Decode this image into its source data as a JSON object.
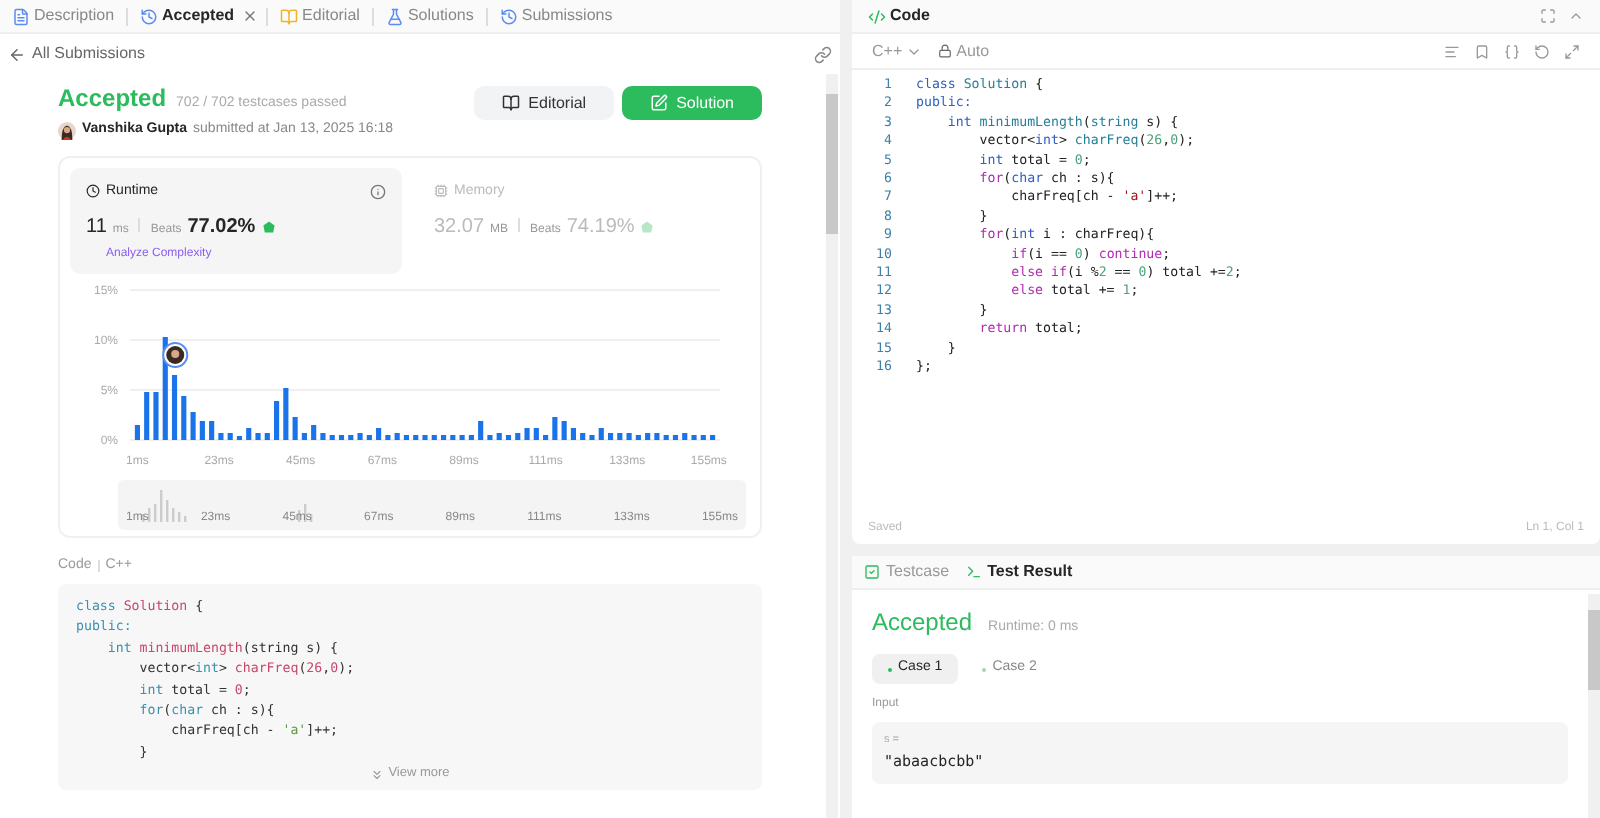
{
  "left_tabs": [
    {
      "label": "Description",
      "kind": "description",
      "selected": false,
      "closable": false
    },
    {
      "label": "Accepted",
      "kind": "history",
      "selected": true,
      "closable": true
    },
    {
      "label": "Editorial",
      "kind": "book",
      "selected": false,
      "closable": false
    },
    {
      "label": "Solutions",
      "kind": "flask",
      "selected": false,
      "closable": false
    },
    {
      "label": "Submissions",
      "kind": "history",
      "selected": false,
      "closable": false
    }
  ],
  "back_link": "All Submissions",
  "submission": {
    "status": "Accepted",
    "passed": "702 / 702 testcases passed",
    "author": "Vanshika Gupta",
    "submitted": "submitted at Jan 13, 2025 16:18"
  },
  "actions": [
    {
      "label": "Editorial",
      "kind": "secondary"
    },
    {
      "label": "Solution",
      "kind": "primary"
    }
  ],
  "metrics": [
    {
      "title": "Runtime",
      "kind": "time",
      "value": "11",
      "unit": "ms",
      "beats_label": "Beats",
      "beats": "77.02%",
      "selected": true,
      "link": "Analyze Complexity"
    },
    {
      "title": "Memory",
      "kind": "memory",
      "value": "32.07",
      "unit": "MB",
      "beats_label": "Beats",
      "beats": "74.19%",
      "selected": false
    }
  ],
  "chart_data": {
    "type": "bar",
    "x": [
      1,
      3.5,
      6,
      8.5,
      11,
      13.5,
      16,
      18.5,
      21,
      23.5,
      26,
      28.5,
      31,
      33.5,
      36,
      38.5,
      41,
      43.5,
      46,
      48.5,
      51,
      53.5,
      56,
      58.5,
      61,
      63.5,
      66,
      68.5,
      71,
      73.5,
      76,
      78.5,
      81,
      83.5,
      86,
      88.5,
      91,
      93.5,
      96,
      98.5,
      101,
      103.5,
      106,
      108.5,
      111,
      113.5,
      116,
      118.5,
      121,
      123.5,
      126,
      128.5,
      131,
      133.5,
      136,
      138.5,
      141,
      143.5,
      146,
      148.5,
      151,
      153.5,
      156
    ],
    "series": [
      {
        "color": "#1a73e8",
        "values": [
          1.5,
          4.8,
          4.8,
          10.3,
          6.5,
          4.4,
          2.8,
          1.9,
          1.9,
          0.7,
          0.7,
          0.4,
          1.2,
          0.7,
          0.7,
          3.9,
          5.2,
          2.3,
          0.7,
          1.5,
          0.7,
          0.5,
          0.5,
          0.5,
          0.7,
          0.5,
          1.2,
          0.5,
          0.7,
          0.5,
          0.5,
          0.5,
          0.5,
          0.5,
          0.5,
          0.5,
          0.5,
          1.9,
          0.5,
          0.7,
          0.5,
          0.7,
          1.2,
          1.2,
          0.5,
          2.3,
          1.9,
          1.2,
          0.7,
          0.5,
          1.2,
          0.7,
          0.7,
          0.7,
          0.5,
          0.7,
          0.7,
          0.5,
          0.5,
          0.7,
          0.5,
          0.5,
          0.5
        ]
      }
    ],
    "ylim": [
      0,
      15
    ],
    "yticks": [
      {
        "value": 0,
        "label": "0%"
      },
      {
        "value": 5,
        "label": "5%"
      },
      {
        "value": 10,
        "label": "10%"
      },
      {
        "value": 15,
        "label": "15%"
      }
    ],
    "xlim": [
      -1,
      158
    ],
    "xticks": [
      {
        "value": 1,
        "label": "1ms"
      },
      {
        "value": 23,
        "label": "23ms"
      },
      {
        "value": 45,
        "label": "45ms"
      },
      {
        "value": 67,
        "label": "67ms"
      },
      {
        "value": 89,
        "label": "89ms"
      },
      {
        "value": 111,
        "label": "111ms"
      },
      {
        "value": 133,
        "label": "133ms"
      },
      {
        "value": 155,
        "label": "155ms"
      }
    ]
  },
  "range_labels": [
    "1ms",
    "23ms",
    "45ms",
    "67ms",
    "89ms",
    "111ms",
    "133ms",
    "155ms"
  ],
  "code_header": {
    "title": "Code",
    "language": "C++"
  },
  "code_preview": [
    [
      {
        "kind": "keyword",
        "text": "class "
      },
      {
        "kind": "func",
        "text": "Solution"
      },
      {
        "kind": "plain",
        "text": " {"
      }
    ],
    [
      {
        "kind": "keyword",
        "text": "public:"
      }
    ],
    [
      {
        "kind": "keyword",
        "text": "    int "
      },
      {
        "kind": "func",
        "text": "minimumLength"
      },
      {
        "kind": "plain",
        "text": "(string s) {"
      }
    ],
    [
      {
        "kind": "plain",
        "text": "        vector<"
      },
      {
        "kind": "keyword",
        "text": "int"
      },
      {
        "kind": "plain",
        "text": "> "
      },
      {
        "kind": "func",
        "text": "charFreq"
      },
      {
        "kind": "plain",
        "text": "("
      },
      {
        "kind": "number",
        "text": "26"
      },
      {
        "kind": "plain",
        "text": ","
      },
      {
        "kind": "number",
        "text": "0"
      },
      {
        "kind": "plain",
        "text": ");"
      }
    ],
    [
      {
        "kind": "keyword",
        "text": "        int"
      },
      {
        "kind": "plain",
        "text": " total = "
      },
      {
        "kind": "number",
        "text": "0"
      },
      {
        "kind": "plain",
        "text": ";"
      }
    ],
    [
      {
        "kind": "keyword",
        "text": "        for"
      },
      {
        "kind": "plain",
        "text": "("
      },
      {
        "kind": "keyword",
        "text": "char"
      },
      {
        "kind": "plain",
        "text": " ch : s){"
      }
    ],
    [
      {
        "kind": "plain",
        "text": "            charFreq[ch - "
      },
      {
        "kind": "string",
        "text": "'a'"
      },
      {
        "kind": "plain",
        "text": "]++;"
      }
    ],
    [
      {
        "kind": "plain",
        "text": "        }"
      }
    ]
  ],
  "view_more": "View more",
  "editor": {
    "title": "Code",
    "language": "C++",
    "mode": "Auto",
    "status": "Saved",
    "cursor": "Ln 1, Col 1",
    "lines": [
      {
        "no": "1",
        "tokens": [
          {
            "kind": "keyword",
            "text": "class "
          },
          {
            "kind": "func",
            "text": "Solution"
          },
          {
            "kind": "plain",
            "text": " {"
          }
        ]
      },
      {
        "no": "2",
        "tokens": [
          {
            "kind": "keyword",
            "text": "public:"
          }
        ]
      },
      {
        "no": "3",
        "tokens": [
          {
            "kind": "keyword",
            "text": "    int "
          },
          {
            "kind": "func",
            "text": "minimumLength"
          },
          {
            "kind": "plain",
            "text": "("
          },
          {
            "kind": "func",
            "text": "string"
          },
          {
            "kind": "plain",
            "text": " s) {"
          }
        ]
      },
      {
        "no": "4",
        "tokens": [
          {
            "kind": "plain",
            "text": "        vector<"
          },
          {
            "kind": "keyword",
            "text": "int"
          },
          {
            "kind": "plain",
            "text": "> "
          },
          {
            "kind": "func",
            "text": "charFreq"
          },
          {
            "kind": "plain",
            "text": "("
          },
          {
            "kind": "number",
            "text": "26"
          },
          {
            "kind": "plain",
            "text": ","
          },
          {
            "kind": "number",
            "text": "0"
          },
          {
            "kind": "plain",
            "text": ");"
          }
        ]
      },
      {
        "no": "5",
        "tokens": [
          {
            "kind": "keyword",
            "text": "        int"
          },
          {
            "kind": "plain",
            "text": " total = "
          },
          {
            "kind": "number",
            "text": "0"
          },
          {
            "kind": "plain",
            "text": ";"
          }
        ]
      },
      {
        "no": "6",
        "tokens": [
          {
            "kind": "control",
            "text": "        for"
          },
          {
            "kind": "plain",
            "text": "("
          },
          {
            "kind": "keyword",
            "text": "char"
          },
          {
            "kind": "plain",
            "text": " ch : s){"
          }
        ]
      },
      {
        "no": "7",
        "tokens": [
          {
            "kind": "plain",
            "text": "            charFreq[ch - "
          },
          {
            "kind": "string",
            "text": "'a'"
          },
          {
            "kind": "plain",
            "text": "]++;"
          }
        ]
      },
      {
        "no": "8",
        "tokens": [
          {
            "kind": "plain",
            "text": "        }"
          }
        ]
      },
      {
        "no": "9",
        "tokens": [
          {
            "kind": "control",
            "text": "        for"
          },
          {
            "kind": "plain",
            "text": "("
          },
          {
            "kind": "keyword",
            "text": "int"
          },
          {
            "kind": "plain",
            "text": " i : charFreq){"
          }
        ]
      },
      {
        "no": "10",
        "tokens": [
          {
            "kind": "control",
            "text": "            if"
          },
          {
            "kind": "plain",
            "text": "(i == "
          },
          {
            "kind": "number",
            "text": "0"
          },
          {
            "kind": "plain",
            "text": ") "
          },
          {
            "kind": "control",
            "text": "continue"
          },
          {
            "kind": "plain",
            "text": ";"
          }
        ]
      },
      {
        "no": "11",
        "tokens": [
          {
            "kind": "control",
            "text": "            else if"
          },
          {
            "kind": "plain",
            "text": "(i %"
          },
          {
            "kind": "number",
            "text": "2"
          },
          {
            "kind": "plain",
            "text": " == "
          },
          {
            "kind": "number",
            "text": "0"
          },
          {
            "kind": "plain",
            "text": ") total +="
          },
          {
            "kind": "number",
            "text": "2"
          },
          {
            "kind": "plain",
            "text": ";"
          }
        ]
      },
      {
        "no": "12",
        "tokens": [
          {
            "kind": "control",
            "text": "            else"
          },
          {
            "kind": "plain",
            "text": " total += "
          },
          {
            "kind": "number",
            "text": "1"
          },
          {
            "kind": "plain",
            "text": ";"
          }
        ]
      },
      {
        "no": "13",
        "tokens": [
          {
            "kind": "plain",
            "text": "        }"
          }
        ]
      },
      {
        "no": "14",
        "tokens": [
          {
            "kind": "control",
            "text": "        return"
          },
          {
            "kind": "plain",
            "text": " total;"
          }
        ]
      },
      {
        "no": "15",
        "tokens": [
          {
            "kind": "plain",
            "text": "    }"
          }
        ]
      },
      {
        "no": "16",
        "tokens": [
          {
            "kind": "plain",
            "text": "};"
          }
        ]
      }
    ]
  },
  "result_tabs": [
    {
      "label": "Testcase",
      "kind": "testcase",
      "selected": false
    },
    {
      "label": "Test Result",
      "kind": "result",
      "selected": true
    }
  ],
  "result": {
    "status": "Accepted",
    "runtime": "Runtime: 0 ms",
    "cases": [
      {
        "label": "Case 1",
        "selected": true
      },
      {
        "label": "Case 2",
        "selected": false
      }
    ],
    "input_label": "Input",
    "var": "s =",
    "value": "\"abaacbcbb\""
  }
}
